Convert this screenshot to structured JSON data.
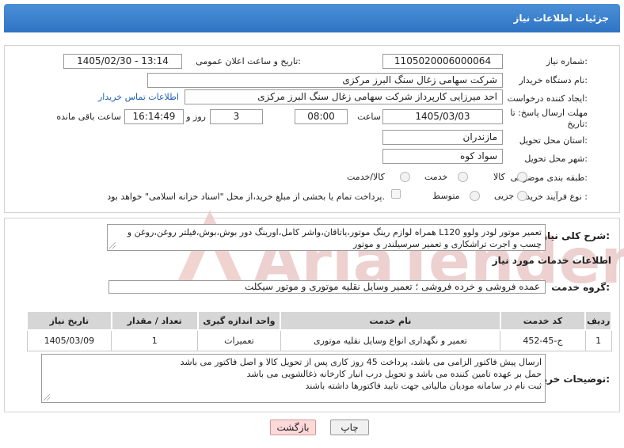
{
  "header": {
    "title": "جزئیات اطلاعات نیاز"
  },
  "form": {
    "need_number_label": "شماره نیاز:",
    "need_number": "1105020006000064",
    "announce_label": "تاریخ و ساعت اعلان عمومی:",
    "announce_value": "1405/02/30 - 13:14",
    "buyer_org_label": "نام دستگاه خریدار:",
    "buyer_org": "شرکت سهامی زغال سنگ البرز مرکزی",
    "creator_label": "ایجاد کننده درخواست:",
    "creator": "احد میرزایی کارپرداز شرکت سهامی زغال سنگ البرز مرکزی",
    "contact_link": "اطلاعات تماس خریدار",
    "deadline_label_1": "مهلت ارسال پاسخ: تا",
    "deadline_label_2": "تاریخ:",
    "deadline_date": "1405/03/03",
    "hour_label": "ساعت",
    "deadline_time": "08:00",
    "days_value": "3",
    "days_label": "روز و",
    "remaining_time": "16:14:49",
    "remaining_label": "ساعت باقی مانده",
    "province_label": "استان محل تحویل:",
    "province": "مازندران",
    "city_label": "شهر محل تحویل:",
    "city": "سواد کوه",
    "category_label": "طبقه بندی موضوعی:",
    "category_options": [
      "کالا",
      "خدمت",
      "کالا/خدمت"
    ],
    "process_label": "نوع فرآیند خرید :",
    "process_options": [
      "جزیی",
      "متوسط"
    ],
    "payment_note": "پرداخت تمام یا بخشی از مبلغ خرید،از محل \"اسناد خزانه اسلامی\" خواهد بود."
  },
  "details": {
    "summary_label": "شرح کلی نیاز:",
    "summary_lines": [
      "تعمیر موتور لودر ولوو L120 همراه لوازم رینگ موتور،یاتاقان،واشر کامل،اورینگ دور بوش،بوش،فیلتر روغن،روغن و",
      "چسب و اجرت تراشکاری و تعمیر سرسیلندر و موتور"
    ],
    "services_title": "اطلاعات خدمات مورد نیاز",
    "service_group_label": "گروه خدمت:",
    "service_group": "عمده فروشی و خرده فروشی ؛ تعمیر وسایل نقلیه موتوری و موتور سیکلت",
    "table": {
      "headers": [
        "ردیف",
        "کد خدمت",
        "نام خدمت",
        "واحد اندازه گیری",
        "تعداد / مقدار",
        "تاریخ نیاز"
      ],
      "rows": [
        [
          "1",
          "ج-45-452",
          "تعمیر و نگهداری انواع وسایل نقلیه موتوری",
          "تعمیرات",
          "1",
          "1405/03/09"
        ]
      ]
    },
    "buyer_notes_label": "توضیحات خریدار:",
    "buyer_notes_lines": [
      "ارسال پیش فاکتور الزامی می باشد، پرداخت 45 روز کاری پس از تحویل کالا و اصل فاکتور می باشد",
      "حمل بر عهده تامین کننده می باشد و تحویل درب انبار کارخانه ذغالشویی می باشد",
      "ثبت نام در سامانه مودیان مالیاتی جهت تایید فاکتورها داشته باشند"
    ]
  },
  "buttons": {
    "print": "چاپ",
    "back": "بازگشت"
  },
  "watermark": {
    "text": "AriaTender.neT"
  },
  "colors": {
    "header": "#3a80cf",
    "link": "#1a5fb4",
    "back_button": "#ffd9d9",
    "watermark": "#ecc8c8"
  }
}
